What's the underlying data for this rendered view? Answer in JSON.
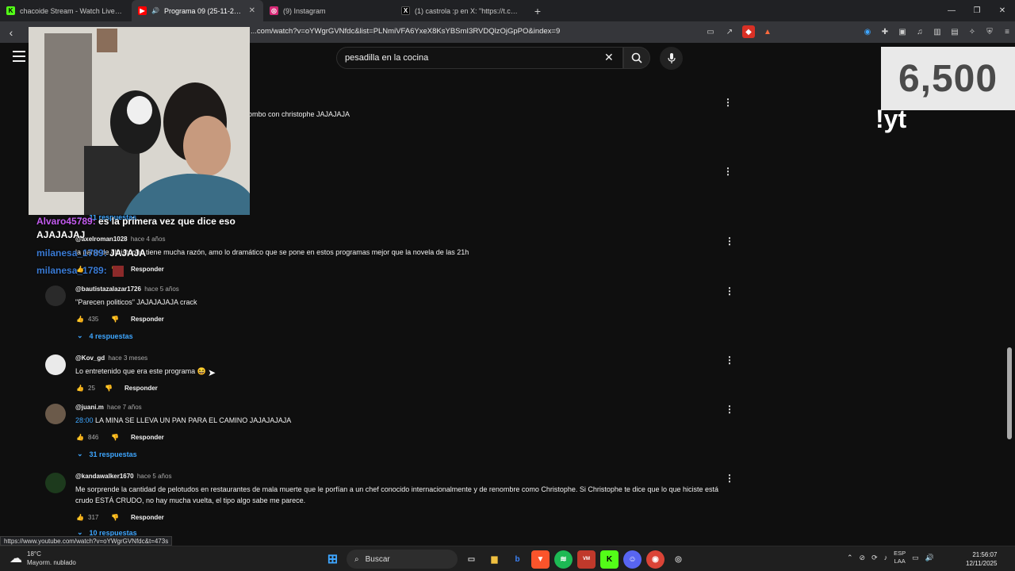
{
  "browser": {
    "tabs": [
      {
        "title": "chacoide Stream - Watch Live on Kick",
        "favicon_color": "#53fc18",
        "favicon_glyph": "K",
        "active": false
      },
      {
        "title": "Programa 09 (25-11-2016) Pe",
        "favicon_color": "#ff0000",
        "favicon_glyph": "▶",
        "active": true
      },
      {
        "title": "(9) Instagram",
        "favicon_color": "#d62976",
        "favicon_glyph": "◎",
        "active": false
      },
      {
        "title": "(1) castrola :p en X: \"https://t.co/8HD",
        "favicon_color": "#000000",
        "favicon_glyph": "X",
        "active": false
      }
    ],
    "url": "...com/watch?v=oYWgrGVNfdc&list=PLNmiVFA6YxeX8KsYBSmI3RVDQlzOjGpPO&index=9",
    "status_url": "https://www.youtube.com/watch?v=oYWgrGVNfdc&t=473s"
  },
  "youtube": {
    "search_value": "pesadilla en la cocina"
  },
  "comments_partial": {
    "line1_fragment": "ombo con christophe  JAJAJAJA",
    "replies_label": "11 respuestas"
  },
  "comments": [
    {
      "user": "@axelroman1028",
      "time": "hace 4 años",
      "ts": "",
      "text": "la parte de christophe tiene mucha razón, amo lo dramático que se pone en estos programas mejor que la novela de las 21h",
      "likes": "",
      "reply_label": "Responder",
      "replies": ""
    },
    {
      "user": "@bautistazalazar1726",
      "time": "hace 5 años",
      "ts": "",
      "text": "\"Parecen politicos\" JAJAJAJAJA crack",
      "likes": "435",
      "reply_label": "Responder",
      "replies": "4 respuestas"
    },
    {
      "user": "@Kov_gd",
      "time": "hace 3 meses",
      "ts": "",
      "text": "Lo entretenido que era este programa 😆",
      "likes": "25",
      "reply_label": "Responder",
      "replies": ""
    },
    {
      "user": "@juani.m",
      "time": "hace 7 años",
      "ts": "28:00",
      "text": " LA MINA SE LLEVA UN PAN PARA EL CAMINO JAJAJAJAJA",
      "likes": "846",
      "reply_label": "Responder",
      "replies": "31 respuestas"
    },
    {
      "user": "@kandawalker1670",
      "time": "hace 5 años",
      "ts": "",
      "text": "Me sorprende la cantidad de pelotudos en restaurantes de mala muerte que le porfían a un chef conocido internacionalmente y de renombre como Christophe. Si Christophe te dice que lo que hiciste está crudo ESTÁ CRUDO, no hay mucha vuelta, el tipo algo sabe me parece.",
      "likes": "317",
      "reply_label": "Responder",
      "replies": "10 respuestas"
    }
  ],
  "overlay": {
    "chat": [
      {
        "user": "Alvaro45789:",
        "user_color": "#c45cf0",
        "text": " es la primera vez que dice eso"
      },
      {
        "user": "",
        "user_color": "#ffffff",
        "text": "AJAJAJAJ"
      },
      {
        "user": "milanesa_1789:",
        "user_color": "#3a7bd5",
        "text": " JAJAJA"
      },
      {
        "user": "milanesa_1789:",
        "user_color": "#3a7bd5",
        "text": ""
      }
    ],
    "counter": "6,500",
    "command": "!yt"
  },
  "taskbar": {
    "weather_temp": "18°C",
    "weather_desc": "Mayorm. nublado",
    "search_label": "Buscar",
    "lang_top": "ESP",
    "lang_bottom": "LAA",
    "time": "21:56:07",
    "date": "12/11/2025"
  }
}
